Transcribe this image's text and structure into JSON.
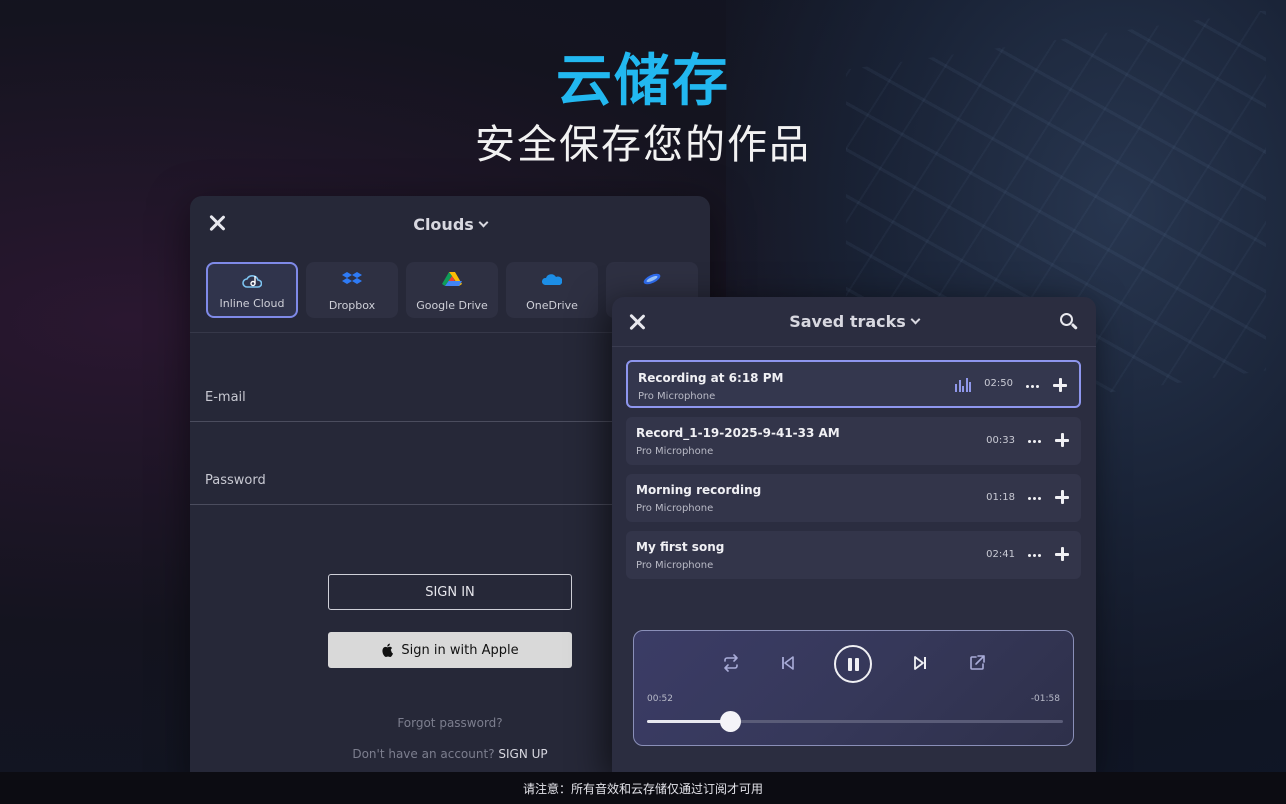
{
  "hero": {
    "title": "云储存",
    "subtitle": "安全保存您的作品"
  },
  "clouds_panel": {
    "title": "Clouds",
    "providers": [
      {
        "label": "Inline Cloud",
        "icon": "inline-cloud-icon",
        "active": true
      },
      {
        "label": "Dropbox",
        "icon": "dropbox-icon",
        "active": false
      },
      {
        "label": "Google Drive",
        "icon": "google-drive-icon",
        "active": false
      },
      {
        "label": "OneDrive",
        "icon": "onedrive-icon",
        "active": false
      },
      {
        "label": "",
        "icon": "cloud-service-icon",
        "active": false
      }
    ],
    "email_label": "E-mail",
    "password_label": "Password",
    "sign_in_label": "SIGN IN",
    "apple_label": "Sign in with Apple",
    "forgot_label": "Forgot password?",
    "no_account_text": "Don't have an account?",
    "sign_up_label": "SIGN UP"
  },
  "tracks_panel": {
    "title": "Saved tracks",
    "tracks": [
      {
        "name": "Recording at 6:18 PM",
        "source": "Pro Microphone",
        "duration": "02:50",
        "playing": true
      },
      {
        "name": "Record_1-19-2025-9-41-33 AM",
        "source": "Pro Microphone",
        "duration": "00:33",
        "playing": false
      },
      {
        "name": "Morning recording",
        "source": "Pro Microphone",
        "duration": "01:18",
        "playing": false
      },
      {
        "name": "My first song",
        "source": "Pro Microphone",
        "duration": "02:41",
        "playing": false
      }
    ],
    "player": {
      "elapsed": "00:52",
      "remaining": "-01:58",
      "progress": 0.2
    }
  },
  "footer": {
    "notice": "请注意：所有音效和云存储仅通过订阅才可用"
  },
  "colors": {
    "accent_title": "#22b8f0",
    "active_border": "#8e96ee",
    "panel_bg": "#262838",
    "tracks_bg": "#2b2d40"
  }
}
